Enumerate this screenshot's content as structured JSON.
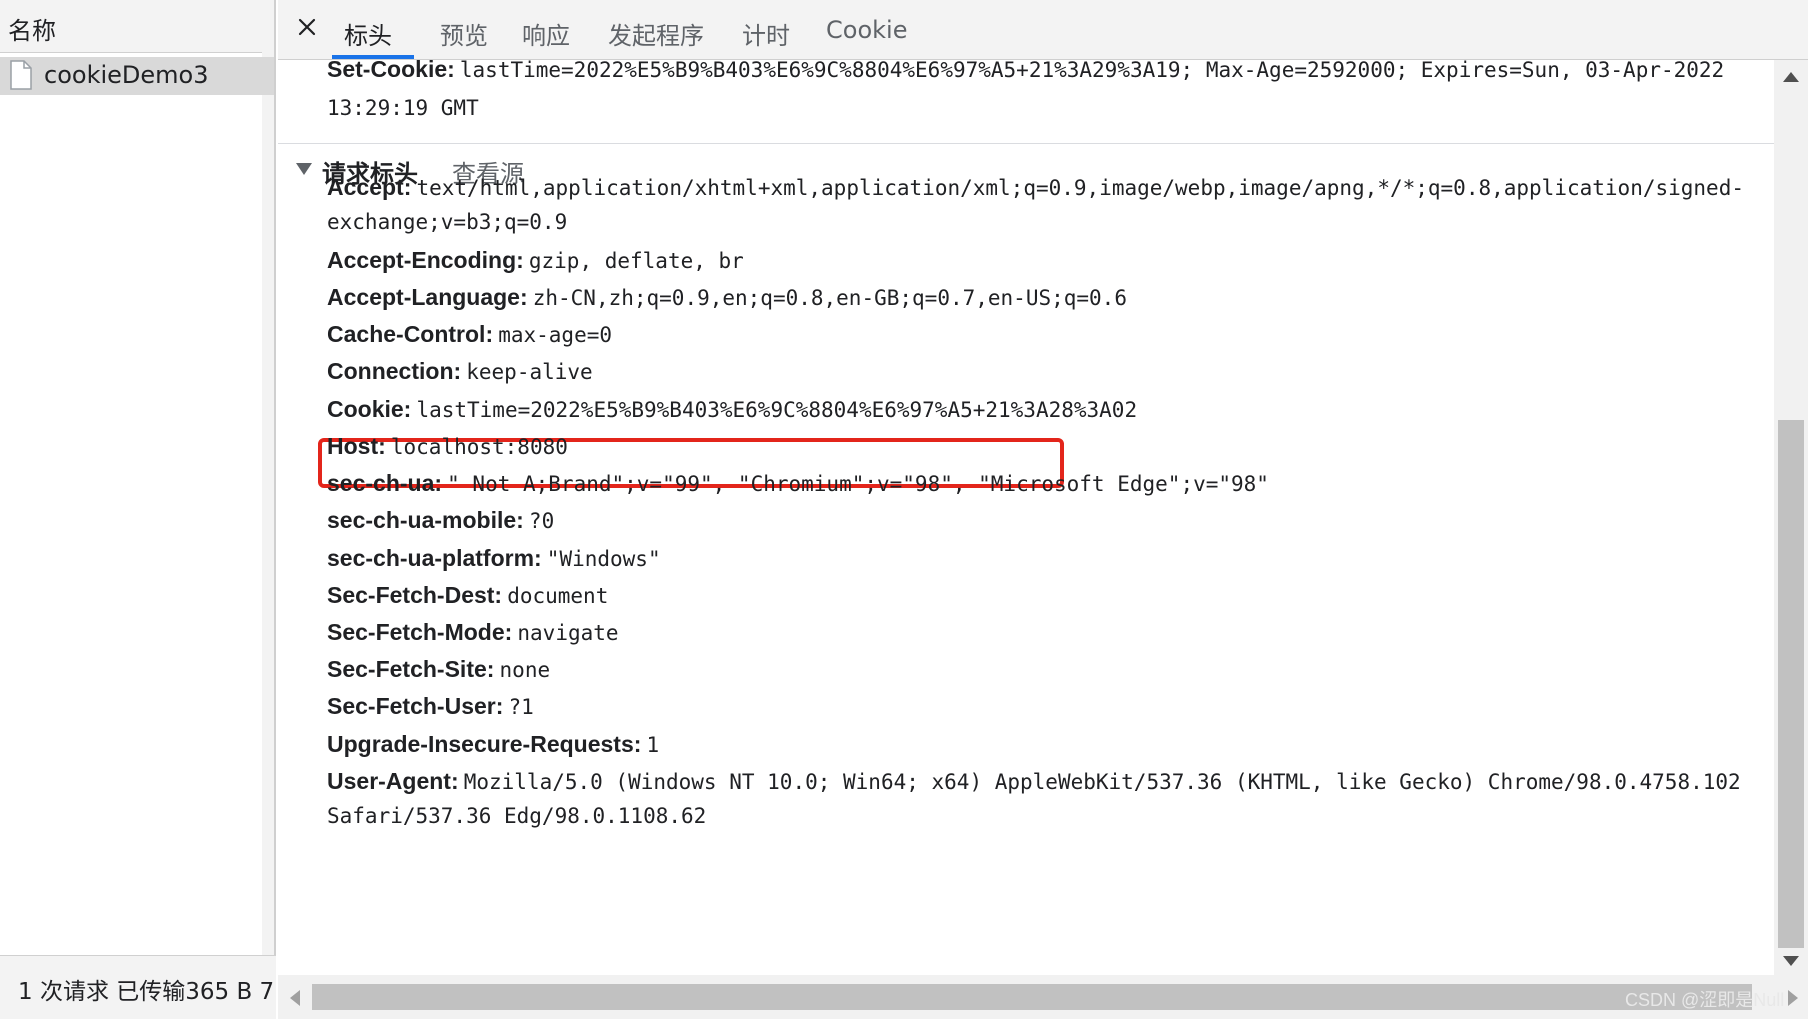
{
  "left_panel": {
    "header": "名称",
    "file_name": "cookieDemo3",
    "status": "1 次请求  已传输365 B  7"
  },
  "tabs": [
    {
      "label": "标头",
      "active": true
    },
    {
      "label": "预览",
      "active": false
    },
    {
      "label": "响应",
      "active": false
    },
    {
      "label": "发起程序",
      "active": false
    },
    {
      "label": "计时",
      "active": false
    },
    {
      "label": "Cookie",
      "active": false
    }
  ],
  "response_tail": {
    "set_cookie_key": "Set-Cookie:",
    "set_cookie_value_1": "lastTime=2022%E5%B9%B403%E6%9C%8804%E6%97%A5+21%3A29%3A19; Max-Age=2592000; Expires=Sun, 03-Apr-2022",
    "set_cookie_value_2": "13:29:19 GMT"
  },
  "request_section": {
    "title": "请求标头",
    "view_source": "查看源"
  },
  "headers": {
    "accept_key": "Accept:",
    "accept_value_1": "text/html,application/xhtml+xml,application/xml;q=0.9,image/webp,image/apng,*/*;q=0.8,application/signed-",
    "accept_value_2": "exchange;v=b3;q=0.9",
    "accept_encoding_key": "Accept-Encoding:",
    "accept_encoding_value": "gzip, deflate, br",
    "accept_language_key": "Accept-Language:",
    "accept_language_value": "zh-CN,zh;q=0.9,en;q=0.8,en-GB;q=0.7,en-US;q=0.6",
    "cache_control_key": "Cache-Control:",
    "cache_control_value": "max-age=0",
    "connection_key": "Connection:",
    "connection_value": "keep-alive",
    "cookie_key": "Cookie:",
    "cookie_value": "lastTime=2022%E5%B9%B403%E6%9C%8804%E6%97%A5+21%3A28%3A02",
    "host_key": "Host:",
    "host_value": "localhost:8080",
    "sec_ch_ua_key": "sec-ch-ua:",
    "sec_ch_ua_value": "\" Not A;Brand\";v=\"99\", \"Chromium\";v=\"98\", \"Microsoft Edge\";v=\"98\"",
    "sec_ch_ua_mobile_key": "sec-ch-ua-mobile:",
    "sec_ch_ua_mobile_value": "?0",
    "sec_ch_ua_platform_key": "sec-ch-ua-platform:",
    "sec_ch_ua_platform_value": "\"Windows\"",
    "sec_fetch_dest_key": "Sec-Fetch-Dest:",
    "sec_fetch_dest_value": "document",
    "sec_fetch_mode_key": "Sec-Fetch-Mode:",
    "sec_fetch_mode_value": "navigate",
    "sec_fetch_site_key": "Sec-Fetch-Site:",
    "sec_fetch_site_value": "none",
    "sec_fetch_user_key": "Sec-Fetch-User:",
    "sec_fetch_user_value": "?1",
    "upgrade_key": "Upgrade-Insecure-Requests:",
    "upgrade_value": "1",
    "user_agent_key": "User-Agent:",
    "user_agent_value_1": "Mozilla/5.0 (Windows NT 10.0; Win64; x64) AppleWebKit/537.36 (KHTML, like Gecko) Chrome/98.0.4758.102",
    "user_agent_value_2": "Safari/537.36 Edg/98.0.1108.62"
  },
  "watermark": "CSDN @涩即是Null",
  "colors": {
    "tab_underline": "#1a73e8",
    "highlight_box": "#e3251b",
    "panel_bg": "#f3f3f3"
  }
}
